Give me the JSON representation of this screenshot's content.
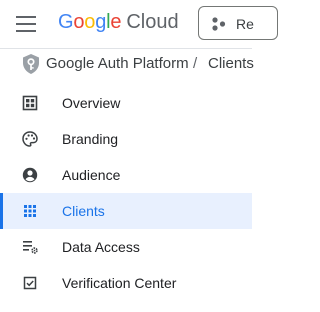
{
  "header": {
    "menu_icon": "hamburger-menu-icon",
    "logo": {
      "google": [
        "G",
        "o",
        "o",
        "g",
        "l",
        "e"
      ],
      "cloud": "Cloud"
    },
    "project_button": {
      "label": "Re",
      "icon": "project-dots-icon"
    }
  },
  "breadcrumb": {
    "icon": "auth-shield-icon",
    "items": [
      "Google Auth Platform",
      "Clients"
    ],
    "separator": "/"
  },
  "nav": {
    "active_index": 3,
    "items": [
      {
        "label": "Overview",
        "icon": "dashboard-icon"
      },
      {
        "label": "Branding",
        "icon": "palette-icon"
      },
      {
        "label": "Audience",
        "icon": "account-circle-icon"
      },
      {
        "label": "Clients",
        "icon": "apps-grid-icon"
      },
      {
        "label": "Data Access",
        "icon": "list-settings-icon"
      },
      {
        "label": "Verification Center",
        "icon": "checkbox-icon"
      }
    ]
  },
  "colors": {
    "accent": "#1a73e8",
    "active_bg": "#e8f0fe",
    "google_blue": "#4285f4",
    "google_red": "#ea4335",
    "google_yellow": "#fbbc04",
    "google_green": "#34a853"
  }
}
